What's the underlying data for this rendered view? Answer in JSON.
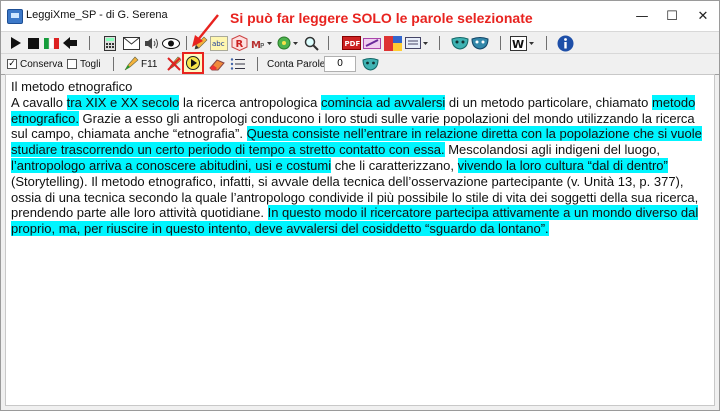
{
  "window": {
    "title": "LeggiXme_SP - di G. Serena",
    "annotation": "Si può far leggere SOLO le parole selezionate",
    "controls": {
      "minimize": "—",
      "maximize": "☐",
      "close": "✕"
    }
  },
  "toolbar1": {
    "icons": [
      "play-icon",
      "stop-icon",
      "flag-italy-icon",
      "back-arrow-icon",
      "calculator-icon",
      "envelope-icon",
      "speaker-icon",
      "eye-icon",
      "spellcheck-abc-icon",
      "r-button-icon",
      "mp-dropdown-icon",
      "green-dropdown-icon",
      "magnifier-icon",
      "pdf-icon",
      "pen-icon",
      "image-icon",
      "tray-icon",
      "mask-icon",
      "word-icon",
      "info-icon"
    ]
  },
  "toolbar2": {
    "keep_label": "Conserva",
    "keep_checked": true,
    "remove_label": "Togli",
    "remove_checked": false,
    "f11_label": "F11",
    "count_label": "Conta Parole",
    "count_value": "0"
  },
  "document": {
    "heading": "Il metodo etnografico",
    "segments": [
      {
        "text": "A cavallo ",
        "highlight": false
      },
      {
        "text": "tra XIX e XX secolo",
        "highlight": true
      },
      {
        "text": " la ricerca antropologica ",
        "highlight": false
      },
      {
        "text": "comincia ad avvalersi",
        "highlight": true
      },
      {
        "text": " di un metodo particolare, chiamato ",
        "highlight": false
      },
      {
        "text": "metodo etnografico.",
        "highlight": true
      },
      {
        "text": " Grazie a esso gli antropologi conducono i loro studi sulle varie popolazioni del mondo utilizzando la ricerca sul campo, chiamata anche “etnografia”. ",
        "highlight": false
      },
      {
        "text": "Questa consiste nell’entrare in relazione diretta con la popolazione che si vuole studiare trascorrendo un certo periodo di tempo a stretto contatto con essa.",
        "highlight": true
      },
      {
        "text": " Mescolandosi agli indigeni del luogo, ",
        "highlight": false
      },
      {
        "text": "l’antropologo arriva a conoscere abitudini, usi e costumi",
        "highlight": true
      },
      {
        "text": " che li caratterizzano, ",
        "highlight": false
      },
      {
        "text": "vivendo la loro cultura “dal di dentro”",
        "highlight": true
      },
      {
        "text": " (Storytelling). Il metodo etnografico, infatti, si avvale della tecnica dell’osservazione partecipante (v. Unità 13, p. 377), ossia di una tecnica secondo la quale l’antropologo condivide il più possibile lo stile di vita dei soggetti della sua ricerca, prendendo parte alle loro attività quotidiane. ",
        "highlight": false
      },
      {
        "text": "In questo modo il ricercatore partecipa attivamente a un mondo diverso dal proprio, ma, per riuscire in questo intento, deve avvalersi del cosiddetto “sguardo da lontano”.",
        "highlight": true
      }
    ]
  },
  "colors": {
    "highlight": "#00f5ff",
    "annotation": "#e8231f"
  }
}
